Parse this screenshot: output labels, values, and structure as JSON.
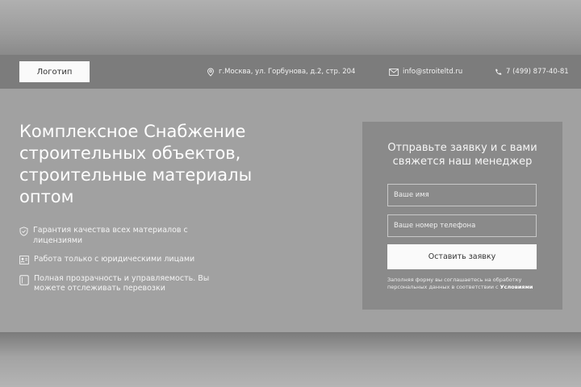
{
  "header": {
    "logo_label": "Логотип",
    "address": "г.Москва, ул. Горбунова, д.2, стр. 204",
    "email": "info@stroiteltd.ru",
    "phone": "7 (499) 877-40-81",
    "icons": [
      "location-icon",
      "mail-icon",
      "phone-icon"
    ]
  },
  "hero": {
    "title": "Комплексное Снабжение строительных объектов, строительные материалы оптом",
    "features": [
      {
        "icon": "shield-icon",
        "text": "Гарантия качества всех материалов с лицензиями"
      },
      {
        "icon": "id-card-icon",
        "text": "Работа только с юридическими лицами"
      },
      {
        "icon": "document-icon",
        "text": "Полная прозрачность и управляемость. Вы можете отслеживать перевозки"
      }
    ]
  },
  "form": {
    "title": "Отправьте заявку и с вами свяжется наш менеджер",
    "name_placeholder": "Ваше имя",
    "phone_placeholder": "Ваше номер телефона",
    "submit_label": "Оставить заявку",
    "note_text": "Заполняя форму вы соглашаетесь на обработку персональных данных в соответствии с ",
    "note_link": "Условиями"
  },
  "colors": {
    "header_bg": "#7c7c7c",
    "hero_bg": "#a1a1a1",
    "form_bg": "#8a8a8a",
    "button_bg": "#fafafa"
  }
}
